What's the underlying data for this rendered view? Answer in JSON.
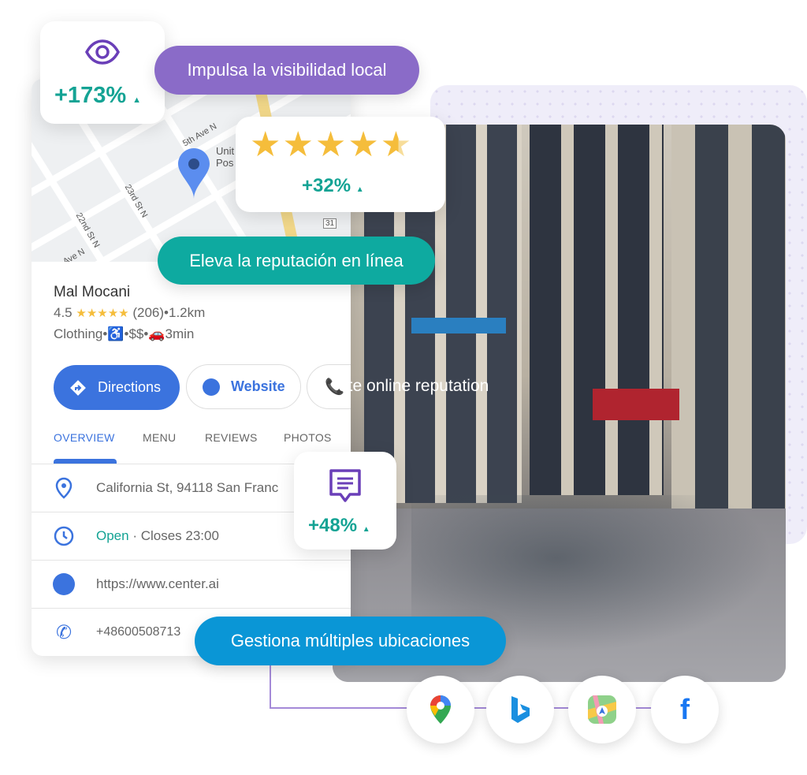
{
  "visibility": {
    "icon": "eye-icon",
    "value": "+173%",
    "trend": "up",
    "label": "Impulsa la visibilidad local",
    "color": "#8a6bc8"
  },
  "rating_badge": {
    "stars": 4.5,
    "value": "+32%",
    "trend": "up"
  },
  "reputation": {
    "label": "Eleva la reputación en línea",
    "color": "#0eaaa0"
  },
  "reviews_badge": {
    "icon": "review-icon",
    "value": "+48%",
    "trend": "up"
  },
  "locations": {
    "label": "Gestiona múltiples ubicaciones",
    "color": "#0a96d6"
  },
  "map": {
    "labels": [
      "5th Ave N",
      "Unit",
      "Pos",
      "23rd St N",
      "22nd St N",
      "Ave N",
      "31"
    ]
  },
  "place": {
    "name": "Mal Mocani",
    "rating": "4.5",
    "stars": "★★★★★",
    "reviews": "(206)",
    "distance": "•1.2km",
    "category": "Clothing",
    "price": "$$",
    "drive_time": "3min",
    "buttons": {
      "directions": "Directions",
      "website": "Website",
      "third": "ate online reputation"
    },
    "tabs": [
      "OVERVIEW",
      "MENU",
      "REVIEWS",
      "PHOTOS"
    ],
    "address": "California St, 94118 San Franc",
    "open": "Open",
    "closes": " · Closes 23:00",
    "url": "https://www.center.ai",
    "phone": "+48600508713"
  },
  "platforms": [
    "google-maps-icon",
    "bing-icon",
    "apple-maps-icon",
    "facebook-icon"
  ],
  "colors": {
    "accent": "#3b73de",
    "teal": "#14a394",
    "star": "#f5bd3b"
  }
}
